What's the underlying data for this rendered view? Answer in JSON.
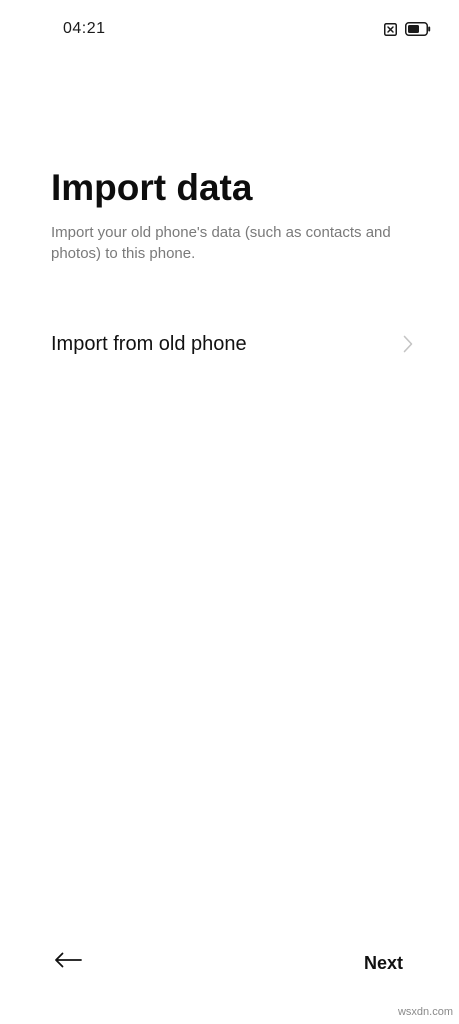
{
  "status_bar": {
    "time": "04:21",
    "icons": [
      "close-box-icon",
      "battery-icon"
    ]
  },
  "page": {
    "title": "Import data",
    "subtitle": "Import your old phone's data (such as contacts and photos) to this phone."
  },
  "options": [
    {
      "label": "Import from old phone",
      "icon": "chevron-right-icon"
    }
  ],
  "footer": {
    "back_icon": "arrow-left-icon",
    "next_label": "Next"
  },
  "watermark": "wsxdn.com",
  "colors": {
    "background": "#ffffff",
    "text_primary": "#111111",
    "text_secondary": "#7a7a7a",
    "chevron": "#c4c4c4"
  }
}
